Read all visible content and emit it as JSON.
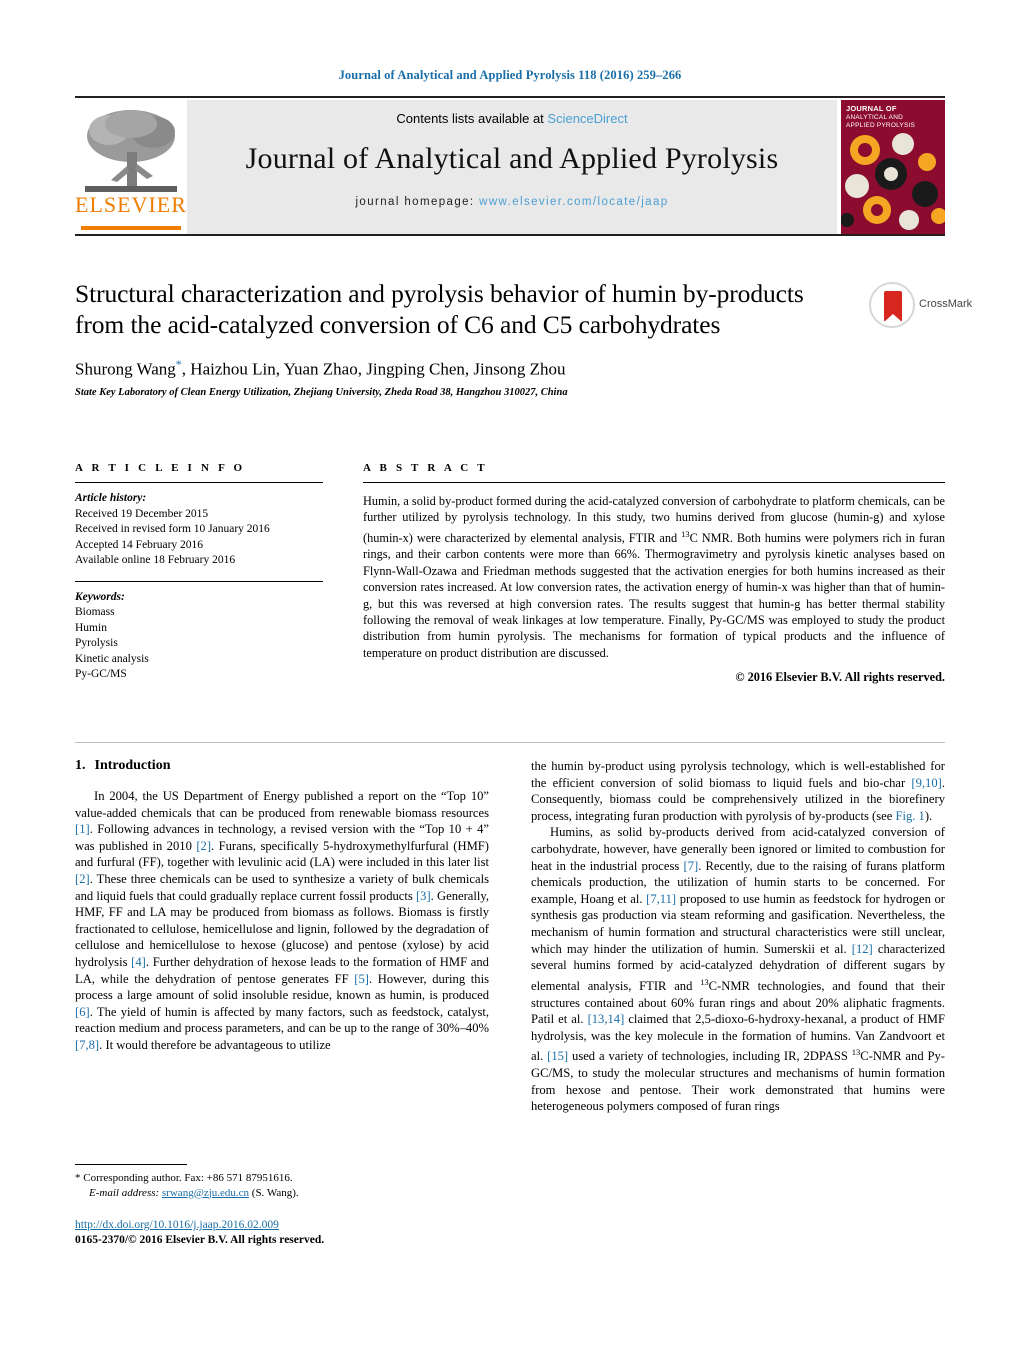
{
  "running_head": "Journal of Analytical and Applied Pyrolysis 118 (2016) 259–266",
  "masthead": {
    "contents_prefix": "Contents lists available at ",
    "sciencedirect": "ScienceDirect",
    "journal_title": "Journal of Analytical and Applied Pyrolysis",
    "homepage_label": "journal homepage:",
    "homepage_url": "www.elsevier.com/locate/jaap",
    "publisher": "ELSEVIER",
    "cover_line1": "JOURNAL OF",
    "cover_line2": "ANALYTICAL AND",
    "cover_line3": "APPLIED PYROLYSIS"
  },
  "article": {
    "title": "Structural characterization and pyrolysis behavior of humin by-products from the acid-catalyzed conversion of C6 and C5 carbohydrates",
    "authors_before_star": "Shurong Wang",
    "authors_after_star": ", Haizhou Lin, Yuan Zhao, Jingping Chen, Jinsong Zhou",
    "corresponding_star": "*",
    "affiliation": "State Key Laboratory of Clean Energy Utilization, Zhejiang University, Zheda Road 38, Hangzhou 310027, China",
    "crossmark_label": "CrossMark"
  },
  "article_info": {
    "heading": "A R T I C L E    I N F O",
    "history_label": "Article history:",
    "history": [
      "Received 19 December 2015",
      "Received in revised form 10 January 2016",
      "Accepted 14 February 2016",
      "Available online 18 February 2016"
    ],
    "keywords_label": "Keywords:",
    "keywords": [
      "Biomass",
      "Humin",
      "Pyrolysis",
      "Kinetic analysis",
      "Py-GC/MS"
    ]
  },
  "abstract": {
    "heading": "A B S T R A C T",
    "part1": "Humin, a solid by-product formed during the acid-catalyzed conversion of carbohydrate to platform chemicals, can be further utilized by pyrolysis technology. In this study, two humins derived from glucose (humin-g) and xylose (humin-x) were characterized by elemental analysis, FTIR and ",
    "sup1": "13",
    "part2": "C NMR. Both humins were polymers rich in furan rings, and their carbon contents were more than 66%. Thermogravimetry and pyrolysis kinetic analyses based on Flynn-Wall-Ozawa and Friedman methods suggested that the activation energies for both humins increased as their conversion rates increased. At low conversion rates, the activation energy of humin-x was higher than that of humin-g, but this was reversed at high conversion rates. The results suggest that humin-g has better thermal stability following the removal of weak linkages at low temperature. Finally, Py-GC/MS was employed to study the product distribution from humin pyrolysis. The mechanisms for formation of typical products and the influence of temperature on product distribution are discussed.",
    "copyright": "© 2016 Elsevier B.V. All rights reserved."
  },
  "introduction": {
    "number": "1.",
    "heading": "Introduction",
    "left_p1_a": "In 2004, the US Department of Energy published a report on the “Top 10” value-added chemicals that can be produced from renewable biomass resources ",
    "left_r1": "[1]",
    "left_p1_b": ". Following advances in technology, a revised version with the “Top 10 + 4” was published in 2010 ",
    "left_r2": "[2]",
    "left_p1_c": ". Furans, specifically 5-hydroxymethylfurfural (HMF) and furfural (FF), together with levulinic acid (LA) were included in this later list ",
    "left_r3": "[2]",
    "left_p1_d": ". These three chemicals can be used to synthesize a variety of bulk chemicals and liquid fuels that could gradually replace current fossil products ",
    "left_r4": "[3]",
    "left_p1_e": ". Generally, HMF, FF and LA may be produced from biomass as follows. Biomass is firstly fractionated to cellulose, hemicellulose and lignin, followed by the degradation of cellulose and hemicellulose to hexose (glucose) and pentose (xylose) by acid hydrolysis ",
    "left_r5": "[4]",
    "left_p1_f": ". Further dehydration of hexose leads to the formation of HMF and LA, while the dehydration of pentose generates FF ",
    "left_r6": "[5]",
    "left_p1_g": ". However, during this process a large amount of solid insoluble residue, known as humin, is produced ",
    "left_r7": "[6]",
    "left_p1_h": ". The yield of humin is affected by many factors, such as feedstock, catalyst, reaction medium and process parameters, and can be up to the range of 30%–40% ",
    "left_r8": "[7,8]",
    "left_p1_i": ". It would therefore be advantageous to utilize",
    "right_p1_a": "the humin by-product using pyrolysis technology, which is well-established for the efficient conversion of solid biomass to liquid fuels and bio-char ",
    "right_r1": "[9,10]",
    "right_p1_b": ". Consequently, biomass could be comprehensively utilized in the biorefinery process, integrating furan production with pyrolysis of by-products (see ",
    "right_fig": "Fig. 1",
    "right_p1_c": ").",
    "right_p2_a": "Humins, as solid by-products derived from acid-catalyzed conversion of carbohydrate, however, have generally been ignored or limited to combustion for heat in the industrial process ",
    "right_r2": "[7]",
    "right_p2_b": ". Recently, due to the raising of furans platform chemicals production, the utilization of humin starts to be concerned. For example, Hoang et al. ",
    "right_r3": "[7,11]",
    "right_p2_c": " proposed to use humin as feedstock for hydrogen or synthesis gas production via steam reforming and gasification. Nevertheless, the mechanism of humin formation and structural characteristics were still unclear, which may hinder the utilization of humin. Sumerskii et al. ",
    "right_r4": "[12]",
    "right_p2_d": " characterized several humins formed by acid-catalyzed dehydration of different sugars by elemental analysis, FTIR and ",
    "right_sup1": "13",
    "right_p2_e": "C-NMR technologies, and found that their structures contained about 60% furan rings and about 20% aliphatic fragments. Patil et al. ",
    "right_r5": "[13,14]",
    "right_p2_f": " claimed that 2,5-dioxo-6-hydroxy-hexanal, a product of HMF hydrolysis, was the key molecule in the formation of humins. Van Zandvoort et al. ",
    "right_r6": "[15]",
    "right_p2_g": " used a variety of technologies, including IR, 2DPASS ",
    "right_sup2": "13",
    "right_p2_h": "C-NMR and Py-GC/MS, to study the molecular structures and mechanisms of humin formation from hexose and pentose. Their work demonstrated that humins were heterogeneous polymers composed of furan rings"
  },
  "footnote": {
    "star": "*",
    "corresponding": " Corresponding author. Fax: +86 571 87951616.",
    "email_label": "E-mail address:",
    "email": "srwang@zju.edu.cn",
    "email_suffix": " (S. Wang)."
  },
  "doi": {
    "url": "http://dx.doi.org/10.1016/j.jaap.2016.02.009",
    "issn_line": "0165-2370/© 2016 Elsevier B.V. All rights reserved."
  },
  "colors": {
    "link": "#1a6ea8",
    "sciencedirect": "#4a9fd4",
    "elsevier_orange": "#f07c00",
    "cover_red": "#8c0c2f"
  }
}
